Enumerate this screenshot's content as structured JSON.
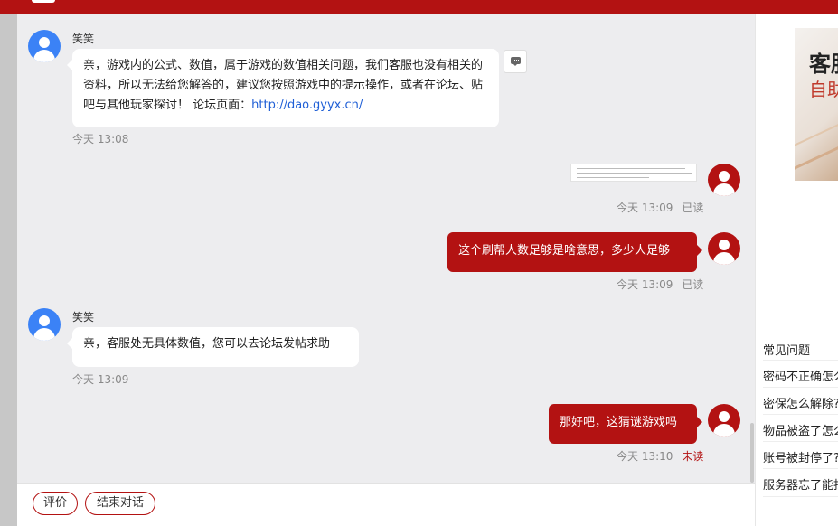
{
  "chat": {
    "messages": [
      {
        "sender": "笑笑",
        "text_before_link": "亲，游戏内的公式、数值，属于游戏的数值相关问题，我们客服也没有相关的资料，所以无法给您解答的，建议您按照游戏中的提示操作，或者在论坛、贴吧与其他玩家探讨！ 论坛页面：",
        "link": "http://dao.gyyx.cn/",
        "time": "今天 13:08"
      },
      {
        "type": "image",
        "time": "今天 13:09",
        "status": "已读"
      },
      {
        "text": "这个刷帮人数足够是啥意思，多少人足够",
        "time": "今天 13:09",
        "status": "已读"
      },
      {
        "sender": "笑笑",
        "text": "亲，客服处无具体数值，您可以去论坛发帖求助",
        "time": "今天 13:09"
      },
      {
        "text": "那好吧，这猜谜游戏吗",
        "time": "今天 13:10",
        "status": "未读"
      }
    ]
  },
  "bottom": {
    "rate_label": "评价",
    "end_label": "结束对话"
  },
  "sidebar": {
    "ad": {
      "title": "客服",
      "subtitle": "自助"
    },
    "faq_title": "常见问题",
    "faq": [
      "密码不正确怎么",
      "密保怎么解除?",
      "物品被盗了怎么",
      "账号被封停了?",
      "服务器忘了能找"
    ]
  },
  "colors": {
    "brand": "#b31212",
    "link": "#1f5fd6",
    "chat_bg": "#ededef"
  },
  "icons": [
    "comment-icon",
    "user-avatar-icon"
  ]
}
